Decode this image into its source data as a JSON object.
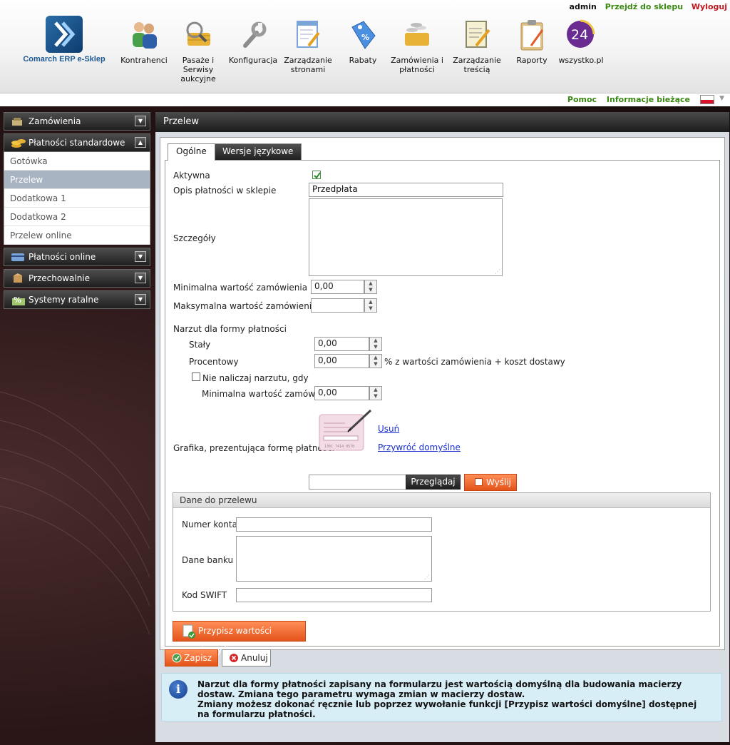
{
  "user": {
    "name": "admin",
    "goto_shop": "Przejdź do sklepu",
    "logout": "Wyloguj"
  },
  "logo": {
    "text": "Comarch ERP e-Sklep"
  },
  "nav": [
    {
      "label": "Kontrahenci",
      "icon": "people-icon"
    },
    {
      "label": "Pasaże i Serwisy aukcyjne",
      "icon": "magnifier-basket-icon"
    },
    {
      "label": "Konfiguracja",
      "icon": "wrench-icon"
    },
    {
      "label": "Zarządzanie stronami",
      "icon": "page-edit-icon"
    },
    {
      "label": "Rabaty",
      "icon": "discount-tag-icon"
    },
    {
      "label": "Zamówienia i płatności",
      "icon": "basket-coins-icon"
    },
    {
      "label": "Zarządzanie treścią",
      "icon": "document-edit-icon"
    },
    {
      "label": "Raporty",
      "icon": "clipboard-icon"
    },
    {
      "label": "wszystko.pl",
      "icon": "wszystko-24-icon"
    }
  ],
  "helpbar": {
    "help": "Pomoc",
    "info": "Informacje bieżące"
  },
  "sidebar": {
    "sections": [
      {
        "label": "Zamówienia",
        "icon": "cart-icon"
      },
      {
        "label": "Płatności standardowe",
        "icon": "coins-icon"
      },
      {
        "label": "Płatności online",
        "icon": "card-icon"
      },
      {
        "label": "Przechowalnie",
        "icon": "box-icon"
      },
      {
        "label": "Systemy ratalne",
        "icon": "percent-icon"
      }
    ],
    "standard_items": [
      "Gotówka",
      "Przelew",
      "Dodatkowa 1",
      "Dodatkowa 2",
      "Przelew online"
    ],
    "active_item": "Przelew"
  },
  "main": {
    "title": "Przelew",
    "tabs": {
      "general": "Ogólne",
      "lang": "Wersje językowe"
    },
    "form": {
      "active_label": "Aktywna",
      "active_checked": true,
      "desc_label": "Opis płatności w sklepie",
      "desc_value": "Przedpłata",
      "details_label": "Szczegóły",
      "min_label": "Minimalna wartość zamówienia",
      "min_value": "0,00",
      "max_label": "Maksymalna wartość zamówienia",
      "max_value": "",
      "surcharge_label": "Narzut dla formy płatności",
      "fixed_label": "Stały",
      "fixed_value": "0,00",
      "percent_label": "Procentowy",
      "percent_value": "0,00",
      "percent_suffix": "% z wartości zamówienia + koszt dostawy",
      "no_surcharge_label": "Nie naliczaj narzutu, gdy",
      "no_surcharge_checked": false,
      "min_order_label": "Minimalna wartość zamówienia",
      "min_order_value": "0,00",
      "graphic_label": "Grafika, prezentująca formę płatności",
      "remove_link": "Usuń",
      "restore_link": "Przywróć domyślne",
      "browse_button": "Przeglądaj",
      "send_button": "Wyślij",
      "file_value": ""
    },
    "transfer": {
      "legend": "Dane do przelewu",
      "account_label": "Numer konta",
      "account_value": "",
      "bank_label": "Dane banku",
      "bank_value": "",
      "swift_label": "Kod SWIFT",
      "swift_value": ""
    },
    "assign_defaults_button": "Przypisz wartości domyślne",
    "save_button": "Zapisz",
    "cancel_button": "Anuluj",
    "info": [
      "Narzut dla formy płatności zapisany na formularzu jest wartością domyślną dla budowania macierzy dostaw. Zmiana tego parametru wymaga zmian w macierzy dostaw.",
      "Zmiany możesz dokonać ręcznie lub poprzez wywołanie funkcji [Przypisz wartości domyślne] dostępnej na formularzu płatności."
    ]
  },
  "colors": {
    "accent_orange": "#f26b2e",
    "link_green": "#3a8a12",
    "logout_red": "#c0161c",
    "active_side": "#a8b4c1"
  }
}
